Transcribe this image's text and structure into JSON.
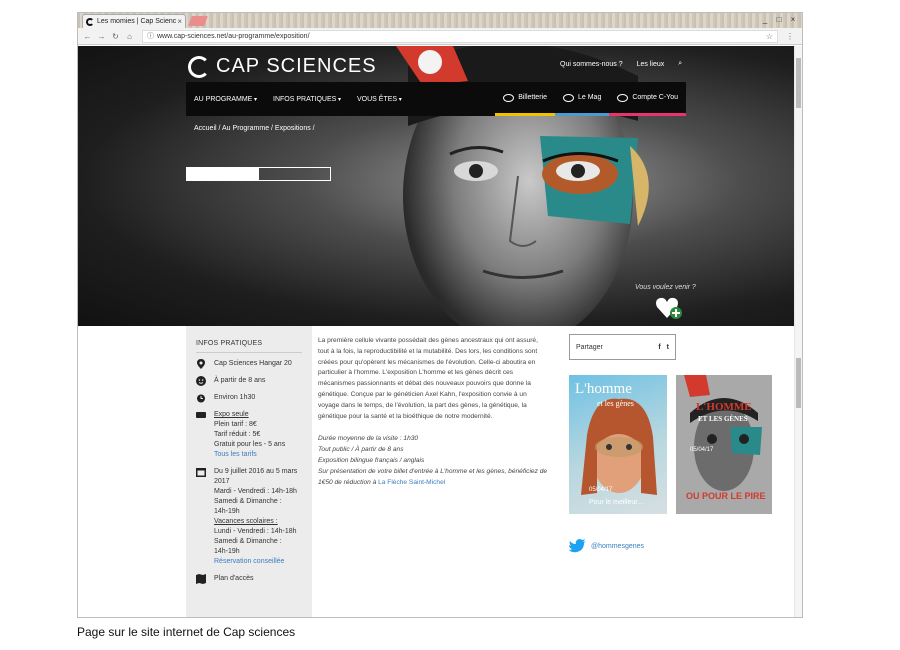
{
  "browser": {
    "tab_title": "Les momies | Cap Scienc",
    "tab_close": "×",
    "url": "www.cap-sciences.net/au-programme/exposition/",
    "lock": "ⓘ",
    "star": "☆",
    "menu": "⋮",
    "nav": {
      "back": "←",
      "forward": "→",
      "reload": "↻",
      "home": "⌂"
    },
    "window": {
      "minimize": "_",
      "maximize": "□",
      "close": "×"
    }
  },
  "site": {
    "logo": "CAP SCIENCES",
    "toplinks": [
      "Qui sommes-nous ?",
      "Les lieux"
    ],
    "search_icon": "⌕",
    "menu": [
      "AU PROGRAMME",
      "INFOS PRATIQUES",
      "VOUS ÊTES"
    ],
    "tabs": [
      {
        "label": "Billetterie",
        "color": "#f2c200"
      },
      {
        "label": "Le Mag",
        "color": "#4b9bd0"
      },
      {
        "label": "Compte C-You",
        "color": "#e8336d"
      }
    ],
    "breadcrumb": "Accueil / Au Programme / Expositions /",
    "progress": 0.5,
    "want_come": "Vous voulez venir ?"
  },
  "sidebar": {
    "title": "INFOS PRATIQUES",
    "location": "Cap Sciences Hangar 20",
    "age": "À partir de 8 ans",
    "duration": "Environ 1h30",
    "pricing": {
      "header": "Expo seule",
      "full": "Plein tarif : 8€",
      "reduced": "Tarif réduit : 5€",
      "free": "Gratuit pour les - 5 ans",
      "all_prices": "Tous les tarifs"
    },
    "dates": {
      "range": "Du 9 juillet 2016 au 5 mars",
      "year": "2017",
      "l1": "Mardi - Vendredi : 14h-18h",
      "l2": "Samedi & Dimanche :",
      "l3": "14h-19h",
      "holidays": "Vacances scolaires :",
      "l4": "Lundi - Vendredi : 14h-18h",
      "l5": "Samedi & Dimanche :",
      "l6": "14h-19h",
      "booking": "Réservation conseillée"
    },
    "access": "Plan d'accès"
  },
  "content": {
    "p1": "La première cellule vivante possédait des gènes ancestraux qui ont assuré, tout à la fois, la reproductibilité et la mutabilité. Des lors, les conditions sont créées pour qu'opèrent les mécanismes de l'évolution. Celle-ci aboutira en particulier à l'homme. L'exposition L'homme et les gènes décrit ces mécanismes passionnants et débat des nouveaux pouvoirs que donne la génétique. Conçue par le généticien Axel Kahn, l'exposition convie à un voyage dans le temps, de l'évolution, la part des gènes, la génétique, la génétique pour la santé et la bioéthique de notre modernité.",
    "d1": "Durée moyenne de la visite : 1h30",
    "d2": "Tout public / À partir de 8 ans",
    "d3": "Exposition bilingue français / anglais",
    "d4": "Sur présentation de votre billet d'entrée à L'homme et les gènes, bénéficiez de 1€50 de réduction à",
    "d4_link": "La Flèche Saint-Michel"
  },
  "share": {
    "label": "Partager",
    "facebook": "f",
    "twitter": "t"
  },
  "posters": {
    "p1_title": "L'homme",
    "p1_sub": "et les gènes",
    "p1_date": "05/04/17",
    "p1_foot": "Pour le meilleur…",
    "p2_title": "L'HOMME",
    "p2_sub": "ET LES GÈNES",
    "p2_date": "05/04/17",
    "p2_foot": "OU POUR LE PIRE"
  },
  "twitter": {
    "handle": "@hommesgenes"
  },
  "caption": "Page sur le site internet de Cap sciences"
}
